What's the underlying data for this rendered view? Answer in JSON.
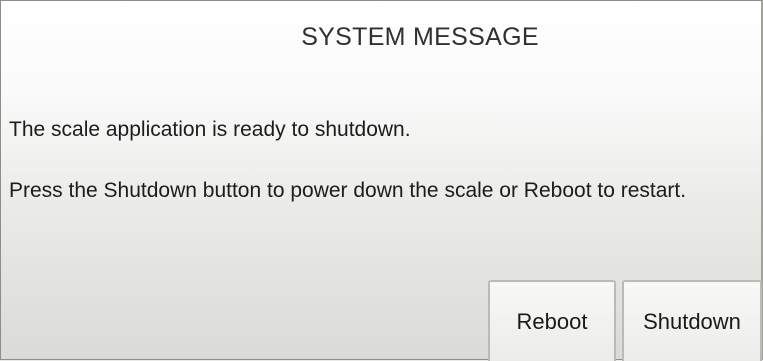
{
  "dialog": {
    "title": "SYSTEM MESSAGE",
    "message_line_1": "The scale application is ready to shutdown.",
    "message_line_2": "Press the Shutdown button to power down the scale or Reboot to restart."
  },
  "buttons": {
    "reboot_label": "Reboot",
    "shutdown_label": "Shutdown"
  }
}
